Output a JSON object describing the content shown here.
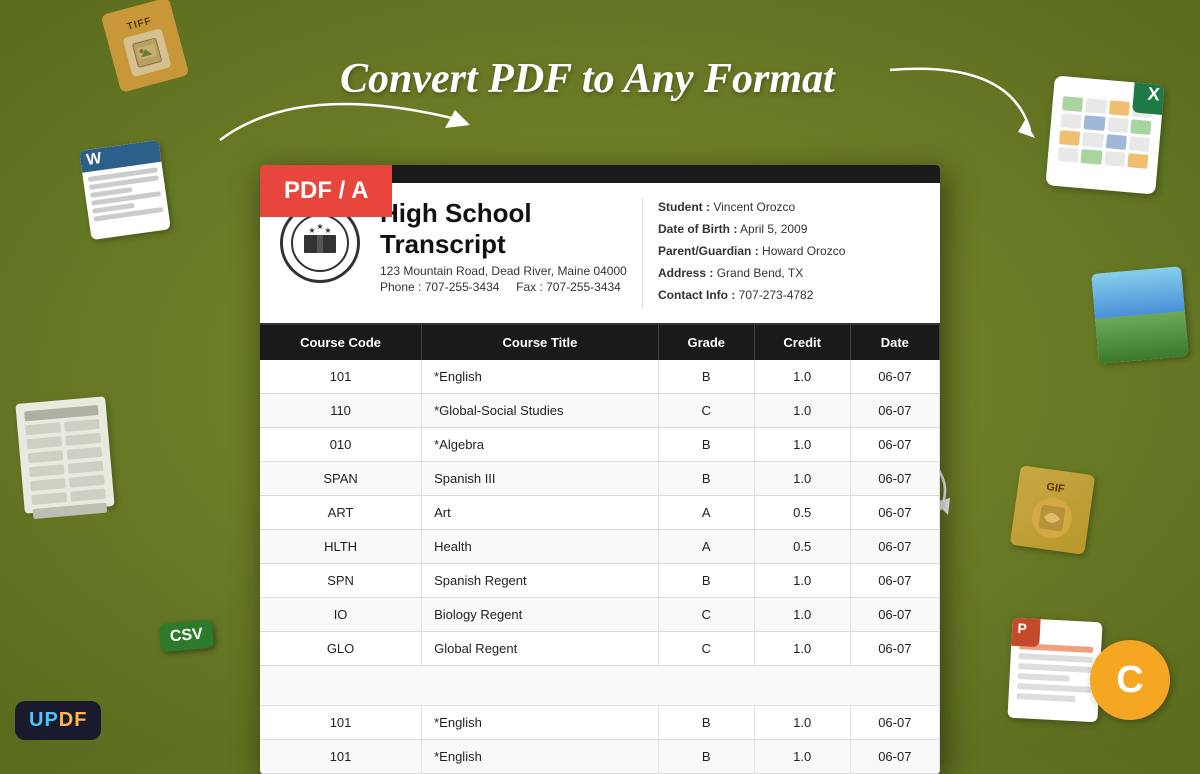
{
  "page": {
    "title": "Convert PDF to Any Format",
    "bg_color": "#6b7a2a"
  },
  "logo": {
    "text_up": "UP",
    "text_df": "DF"
  },
  "badges": {
    "pdf_a": "PDF / A",
    "csv": "CSV",
    "gif": "GIF",
    "tiff": "TIFF"
  },
  "document": {
    "title": "High School Transcript",
    "address": "123 Mountain Road, Dead River, Maine 04000",
    "phone": "Phone : 707-255-3434",
    "fax": "Fax : 707-255-3434",
    "student_label": "Student :",
    "student_name": "Vincent Orozco",
    "dob_label": "Date of Birth :",
    "dob": "April 5,  2009",
    "guardian_label": "Parent/Guardian :",
    "guardian": "Howard Orozco",
    "address_label": "Address :",
    "student_address": "Grand Bend, TX",
    "contact_label": "Contact Info :",
    "contact": "707-273-4782"
  },
  "table": {
    "headers": [
      "Course Code",
      "Course Title",
      "Grade",
      "Credit",
      "Date"
    ],
    "rows": [
      {
        "code": "101",
        "title": "*English",
        "grade": "B",
        "credit": "1.0",
        "date": "06-07"
      },
      {
        "code": "110",
        "title": "*Global-Social Studies",
        "grade": "C",
        "credit": "1.0",
        "date": "06-07"
      },
      {
        "code": "010",
        "title": "*Algebra",
        "grade": "B",
        "credit": "1.0",
        "date": "06-07"
      },
      {
        "code": "SPAN",
        "title": "Spanish III",
        "grade": "B",
        "credit": "1.0",
        "date": "06-07"
      },
      {
        "code": "ART",
        "title": "Art",
        "grade": "A",
        "credit": "0.5",
        "date": "06-07"
      },
      {
        "code": "HLTH",
        "title": "Health",
        "grade": "A",
        "credit": "0.5",
        "date": "06-07"
      },
      {
        "code": "SPN",
        "title": "Spanish Regent",
        "grade": "B",
        "credit": "1.0",
        "date": "06-07"
      },
      {
        "code": "IO",
        "title": "Biology Regent",
        "grade": "C",
        "credit": "1.0",
        "date": "06-07"
      },
      {
        "code": "GLO",
        "title": "Global Regent",
        "grade": "C",
        "credit": "1.0",
        "date": "06-07"
      },
      {
        "code": "",
        "title": "",
        "grade": "",
        "credit": "",
        "date": ""
      },
      {
        "code": "101",
        "title": "*English",
        "grade": "B",
        "credit": "1.0",
        "date": "06-07"
      },
      {
        "code": "101",
        "title": "*English",
        "grade": "B",
        "credit": "1.0",
        "date": "06-07"
      }
    ]
  }
}
